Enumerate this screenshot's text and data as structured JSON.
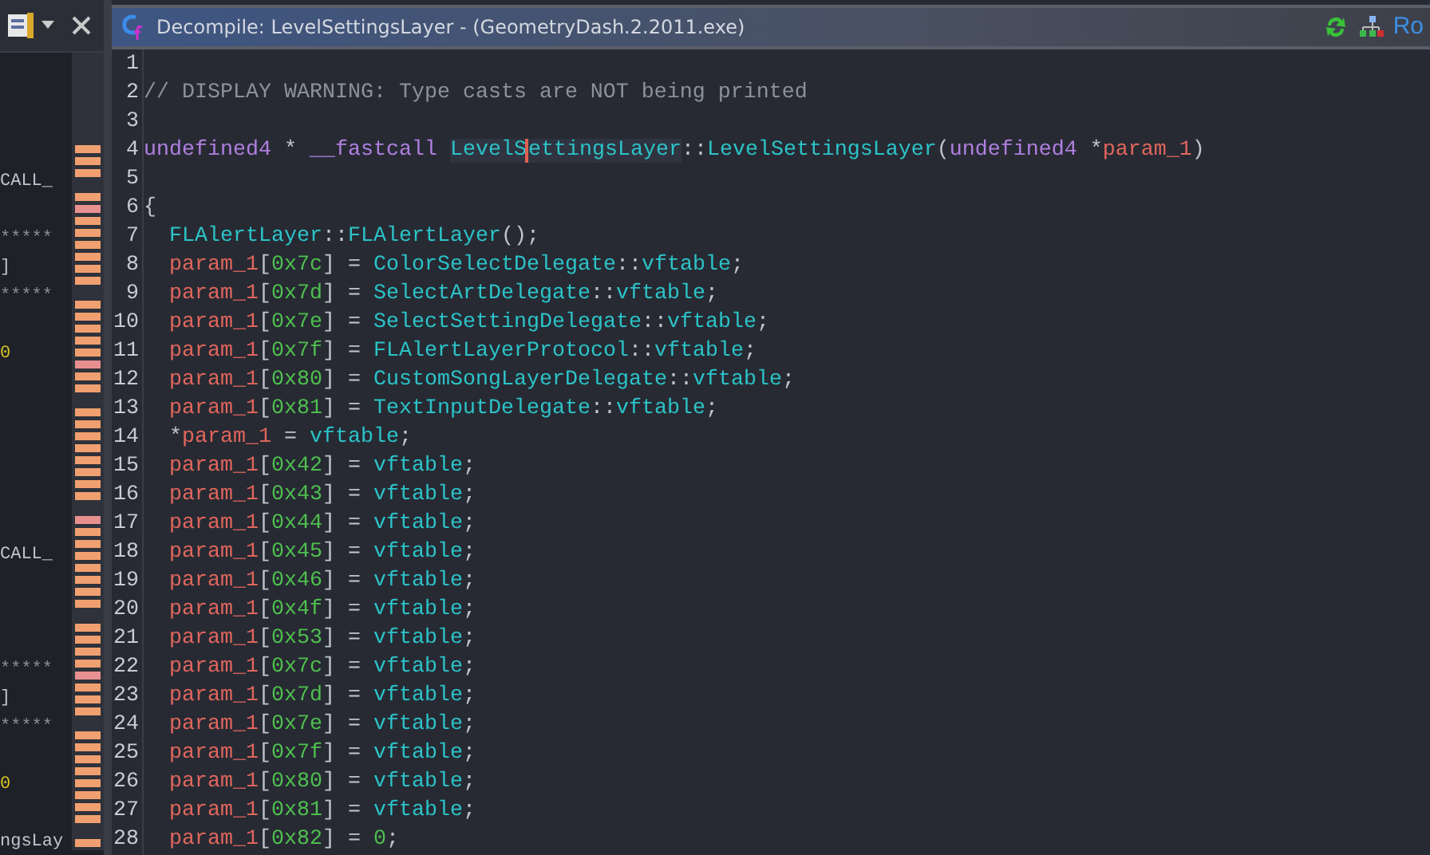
{
  "left_panel": {
    "rows": [
      {
        "kind": "blank"
      },
      {
        "kind": "blank"
      },
      {
        "text": "CALL_",
        "kind": "plain"
      },
      {
        "kind": "blank"
      },
      {
        "text": "*****",
        "kind": "stars"
      },
      {
        "text": "]",
        "kind": "plain"
      },
      {
        "text": "*****",
        "kind": "stars"
      },
      {
        "kind": "blank"
      },
      {
        "text": "0",
        "kind": "number"
      },
      {
        "kind": "blank"
      },
      {
        "kind": "blank"
      },
      {
        "kind": "blank"
      },
      {
        "kind": "blank"
      },
      {
        "kind": "blank"
      },
      {
        "kind": "blank"
      },
      {
        "text": "CALL_",
        "kind": "plain"
      },
      {
        "kind": "blank"
      },
      {
        "kind": "blank"
      },
      {
        "kind": "blank"
      },
      {
        "text": "*****",
        "kind": "stars"
      },
      {
        "text": "]",
        "kind": "plain"
      },
      {
        "text": "*****",
        "kind": "stars"
      },
      {
        "kind": "blank"
      },
      {
        "text": "0",
        "kind": "number"
      },
      {
        "kind": "blank"
      },
      {
        "text": "ngsLay",
        "kind": "plain"
      }
    ]
  },
  "window": {
    "title": "Decompile: LevelSettingsLayer -  (GeometryDash.2.2011.exe)",
    "toolbar_text": "Ro"
  },
  "code": [
    {
      "number": "1"
    },
    {
      "number": "2",
      "tokens": [
        {
          "t": "// DISPLAY WARNING: Type casts are NOT being printed",
          "kind": "comment"
        }
      ]
    },
    {
      "number": "3"
    },
    {
      "number": "4",
      "tokens": [
        {
          "t": "undefined4",
          "kind": "type"
        },
        {
          "t": " * ",
          "kind": "punct"
        },
        {
          "t": "__fastcall ",
          "kind": "type"
        },
        {
          "t": "LevelS",
          "kind": "func",
          "highlight": true,
          "cursor": false
        },
        {
          "t": "ettingsLayer",
          "kind": "func",
          "highlight": true,
          "cursor": true
        },
        {
          "t": "::",
          "kind": "punct"
        },
        {
          "t": "LevelSettingsLayer",
          "kind": "func"
        },
        {
          "t": "(",
          "kind": "punct"
        },
        {
          "t": "undefined4",
          "kind": "type"
        },
        {
          "t": " *",
          "kind": "punct"
        },
        {
          "t": "param_1",
          "kind": "param"
        },
        {
          "t": ")",
          "kind": "punct"
        }
      ]
    },
    {
      "number": "5"
    },
    {
      "number": "6",
      "tokens": [
        {
          "t": "{",
          "kind": "punct"
        }
      ]
    },
    {
      "number": "7",
      "tokens": [
        {
          "t": "  FLAlertLayer",
          "kind": "func"
        },
        {
          "t": "::",
          "kind": "punct"
        },
        {
          "t": "FLAlertLayer",
          "kind": "func"
        },
        {
          "t": "();",
          "kind": "punct"
        }
      ]
    },
    {
      "number": "8",
      "tokens": [
        {
          "t": "  param_1",
          "kind": "param"
        },
        {
          "t": "[",
          "kind": "punct"
        },
        {
          "t": "0x7c",
          "kind": "num"
        },
        {
          "t": "] = ",
          "kind": "punct"
        },
        {
          "t": "ColorSelectDelegate",
          "kind": "func"
        },
        {
          "t": "::",
          "kind": "punct"
        },
        {
          "t": "vftable",
          "kind": "func"
        },
        {
          "t": ";",
          "kind": "punct"
        }
      ]
    },
    {
      "number": "9",
      "tokens": [
        {
          "t": "  param_1",
          "kind": "param"
        },
        {
          "t": "[",
          "kind": "punct"
        },
        {
          "t": "0x7d",
          "kind": "num"
        },
        {
          "t": "] = ",
          "kind": "punct"
        },
        {
          "t": "SelectArtDelegate",
          "kind": "func"
        },
        {
          "t": "::",
          "kind": "punct"
        },
        {
          "t": "vftable",
          "kind": "func"
        },
        {
          "t": ";",
          "kind": "punct"
        }
      ]
    },
    {
      "number": "10",
      "tokens": [
        {
          "t": "  param_1",
          "kind": "param"
        },
        {
          "t": "[",
          "kind": "punct"
        },
        {
          "t": "0x7e",
          "kind": "num"
        },
        {
          "t": "] = ",
          "kind": "punct"
        },
        {
          "t": "SelectSettingDelegate",
          "kind": "func"
        },
        {
          "t": "::",
          "kind": "punct"
        },
        {
          "t": "vftable",
          "kind": "func"
        },
        {
          "t": ";",
          "kind": "punct"
        }
      ]
    },
    {
      "number": "11",
      "tokens": [
        {
          "t": "  param_1",
          "kind": "param"
        },
        {
          "t": "[",
          "kind": "punct"
        },
        {
          "t": "0x7f",
          "kind": "num"
        },
        {
          "t": "] = ",
          "kind": "punct"
        },
        {
          "t": "FLAlertLayerProtocol",
          "kind": "func"
        },
        {
          "t": "::",
          "kind": "punct"
        },
        {
          "t": "vftable",
          "kind": "func"
        },
        {
          "t": ";",
          "kind": "punct"
        }
      ]
    },
    {
      "number": "12",
      "tokens": [
        {
          "t": "  param_1",
          "kind": "param"
        },
        {
          "t": "[",
          "kind": "punct"
        },
        {
          "t": "0x80",
          "kind": "num"
        },
        {
          "t": "] = ",
          "kind": "punct"
        },
        {
          "t": "CustomSongLayerDelegate",
          "kind": "func"
        },
        {
          "t": "::",
          "kind": "punct"
        },
        {
          "t": "vftable",
          "kind": "func"
        },
        {
          "t": ";",
          "kind": "punct"
        }
      ]
    },
    {
      "number": "13",
      "tokens": [
        {
          "t": "  param_1",
          "kind": "param"
        },
        {
          "t": "[",
          "kind": "punct"
        },
        {
          "t": "0x81",
          "kind": "num"
        },
        {
          "t": "] = ",
          "kind": "punct"
        },
        {
          "t": "TextInputDelegate",
          "kind": "func"
        },
        {
          "t": "::",
          "kind": "punct"
        },
        {
          "t": "vftable",
          "kind": "func"
        },
        {
          "t": ";",
          "kind": "punct"
        }
      ]
    },
    {
      "number": "14",
      "tokens": [
        {
          "t": "  *",
          "kind": "punct"
        },
        {
          "t": "param_1",
          "kind": "param"
        },
        {
          "t": " = ",
          "kind": "punct"
        },
        {
          "t": "vftable",
          "kind": "func"
        },
        {
          "t": ";",
          "kind": "punct"
        }
      ]
    },
    {
      "number": "15",
      "tokens": [
        {
          "t": "  param_1",
          "kind": "param"
        },
        {
          "t": "[",
          "kind": "punct"
        },
        {
          "t": "0x42",
          "kind": "num"
        },
        {
          "t": "] = ",
          "kind": "punct"
        },
        {
          "t": "vftable",
          "kind": "func"
        },
        {
          "t": ";",
          "kind": "punct"
        }
      ]
    },
    {
      "number": "16",
      "tokens": [
        {
          "t": "  param_1",
          "kind": "param"
        },
        {
          "t": "[",
          "kind": "punct"
        },
        {
          "t": "0x43",
          "kind": "num"
        },
        {
          "t": "] = ",
          "kind": "punct"
        },
        {
          "t": "vftable",
          "kind": "func"
        },
        {
          "t": ";",
          "kind": "punct"
        }
      ]
    },
    {
      "number": "17",
      "tokens": [
        {
          "t": "  param_1",
          "kind": "param"
        },
        {
          "t": "[",
          "kind": "punct"
        },
        {
          "t": "0x44",
          "kind": "num"
        },
        {
          "t": "] = ",
          "kind": "punct"
        },
        {
          "t": "vftable",
          "kind": "func"
        },
        {
          "t": ";",
          "kind": "punct"
        }
      ]
    },
    {
      "number": "18",
      "tokens": [
        {
          "t": "  param_1",
          "kind": "param"
        },
        {
          "t": "[",
          "kind": "punct"
        },
        {
          "t": "0x45",
          "kind": "num"
        },
        {
          "t": "] = ",
          "kind": "punct"
        },
        {
          "t": "vftable",
          "kind": "func"
        },
        {
          "t": ";",
          "kind": "punct"
        }
      ]
    },
    {
      "number": "19",
      "tokens": [
        {
          "t": "  param_1",
          "kind": "param"
        },
        {
          "t": "[",
          "kind": "punct"
        },
        {
          "t": "0x46",
          "kind": "num"
        },
        {
          "t": "] = ",
          "kind": "punct"
        },
        {
          "t": "vftable",
          "kind": "func"
        },
        {
          "t": ";",
          "kind": "punct"
        }
      ]
    },
    {
      "number": "20",
      "tokens": [
        {
          "t": "  param_1",
          "kind": "param"
        },
        {
          "t": "[",
          "kind": "punct"
        },
        {
          "t": "0x4f",
          "kind": "num"
        },
        {
          "t": "] = ",
          "kind": "punct"
        },
        {
          "t": "vftable",
          "kind": "func"
        },
        {
          "t": ";",
          "kind": "punct"
        }
      ]
    },
    {
      "number": "21",
      "tokens": [
        {
          "t": "  param_1",
          "kind": "param"
        },
        {
          "t": "[",
          "kind": "punct"
        },
        {
          "t": "0x53",
          "kind": "num"
        },
        {
          "t": "] = ",
          "kind": "punct"
        },
        {
          "t": "vftable",
          "kind": "func"
        },
        {
          "t": ";",
          "kind": "punct"
        }
      ]
    },
    {
      "number": "22",
      "tokens": [
        {
          "t": "  param_1",
          "kind": "param"
        },
        {
          "t": "[",
          "kind": "punct"
        },
        {
          "t": "0x7c",
          "kind": "num"
        },
        {
          "t": "] = ",
          "kind": "punct"
        },
        {
          "t": "vftable",
          "kind": "func"
        },
        {
          "t": ";",
          "kind": "punct"
        }
      ]
    },
    {
      "number": "23",
      "tokens": [
        {
          "t": "  param_1",
          "kind": "param"
        },
        {
          "t": "[",
          "kind": "punct"
        },
        {
          "t": "0x7d",
          "kind": "num"
        },
        {
          "t": "] = ",
          "kind": "punct"
        },
        {
          "t": "vftable",
          "kind": "func"
        },
        {
          "t": ";",
          "kind": "punct"
        }
      ]
    },
    {
      "number": "24",
      "tokens": [
        {
          "t": "  param_1",
          "kind": "param"
        },
        {
          "t": "[",
          "kind": "punct"
        },
        {
          "t": "0x7e",
          "kind": "num"
        },
        {
          "t": "] = ",
          "kind": "punct"
        },
        {
          "t": "vftable",
          "kind": "func"
        },
        {
          "t": ";",
          "kind": "punct"
        }
      ]
    },
    {
      "number": "25",
      "tokens": [
        {
          "t": "  param_1",
          "kind": "param"
        },
        {
          "t": "[",
          "kind": "punct"
        },
        {
          "t": "0x7f",
          "kind": "num"
        },
        {
          "t": "] = ",
          "kind": "punct"
        },
        {
          "t": "vftable",
          "kind": "func"
        },
        {
          "t": ";",
          "kind": "punct"
        }
      ]
    },
    {
      "number": "26",
      "tokens": [
        {
          "t": "  param_1",
          "kind": "param"
        },
        {
          "t": "[",
          "kind": "punct"
        },
        {
          "t": "0x80",
          "kind": "num"
        },
        {
          "t": "] = ",
          "kind": "punct"
        },
        {
          "t": "vftable",
          "kind": "func"
        },
        {
          "t": ";",
          "kind": "punct"
        }
      ]
    },
    {
      "number": "27",
      "tokens": [
        {
          "t": "  param_1",
          "kind": "param"
        },
        {
          "t": "[",
          "kind": "punct"
        },
        {
          "t": "0x81",
          "kind": "num"
        },
        {
          "t": "] = ",
          "kind": "punct"
        },
        {
          "t": "vftable",
          "kind": "func"
        },
        {
          "t": ";",
          "kind": "punct"
        }
      ]
    },
    {
      "number": "28",
      "tokens": [
        {
          "t": "  param_1",
          "kind": "param"
        },
        {
          "t": "[",
          "kind": "punct"
        },
        {
          "t": "0x82",
          "kind": "num"
        },
        {
          "t": "] = ",
          "kind": "punct"
        },
        {
          "t": "0",
          "kind": "num"
        },
        {
          "t": ";",
          "kind": "punct"
        }
      ]
    }
  ]
}
